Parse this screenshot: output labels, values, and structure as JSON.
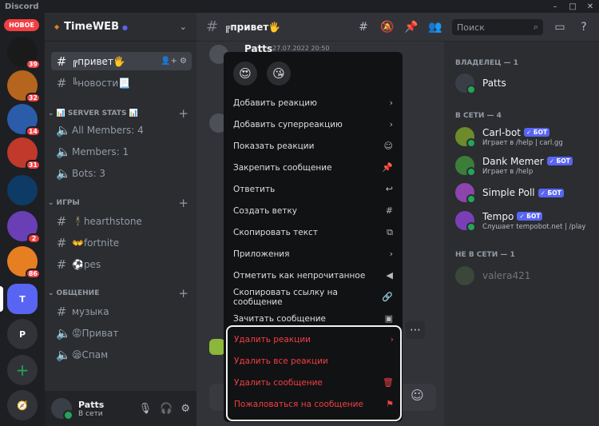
{
  "app": {
    "name": "Discord"
  },
  "window_controls": [
    "–",
    "□",
    "✕"
  ],
  "servers": {
    "new_label": "НОВОЕ",
    "items": [
      {
        "badge": "39",
        "color": "#1a1a1a"
      },
      {
        "badge": "32",
        "color": "#b5651d"
      },
      {
        "badge": "14",
        "color": "#2a5caa"
      },
      {
        "badge": "31",
        "color": "#c0392b"
      },
      {
        "badge": "",
        "color": "#0d3b66"
      },
      {
        "badge": "2",
        "color": "#6a3fb5"
      },
      {
        "badge": "86",
        "color": "#e67e22"
      }
    ],
    "active_label": "T",
    "p_label": "P",
    "add_icon": "plus-icon",
    "explore_icon": "compass-icon"
  },
  "guild": {
    "name": "TimeWEB",
    "channels_top": [
      {
        "name": "╔привет🖐",
        "active": true
      },
      {
        "name": "╚новости📃",
        "active": false
      }
    ],
    "categories": [
      {
        "name": "📊 SERVER STATS 📊",
        "channels": [
          "All Members: 4",
          "Members: 1",
          "Bots: 3"
        ]
      },
      {
        "name": "ИГРЫ",
        "channels": [
          "🕴hearthstone",
          "👐fortnite",
          "⚽pes"
        ]
      },
      {
        "name": "ОБЩЕНИЕ",
        "channels": [
          "музыка",
          "😡Приват",
          "😪Спам"
        ]
      }
    ]
  },
  "user": {
    "name": "Patts",
    "status": "В сети"
  },
  "chat": {
    "channel": "╔привет🖐",
    "search_placeholder": "Поиск",
    "message": {
      "author": "Patts",
      "time": "27.07.2022 20:50"
    }
  },
  "context_menu": {
    "reactions": [
      "😍",
      "😘"
    ],
    "items": [
      {
        "label": "Добавить реакцию",
        "icon": "›"
      },
      {
        "label": "Добавить суперреакцию",
        "icon": "›"
      },
      {
        "label": "Показать реакции",
        "icon": "☺"
      },
      {
        "label": "Закрепить сообщение",
        "icon": "📌"
      },
      {
        "label": "Ответить",
        "icon": "↩"
      },
      {
        "label": "Создать ветку",
        "icon": "#"
      },
      {
        "label": "Скопировать текст",
        "icon": "⧉"
      },
      {
        "label": "Приложения",
        "icon": "›"
      },
      {
        "label": "Отметить как непрочитанное",
        "icon": "◀"
      },
      {
        "label": "Скопировать ссылку на сообщение",
        "icon": "🔗"
      },
      {
        "label": "Зачитать сообщение",
        "icon": "▣"
      }
    ],
    "danger_items": [
      {
        "label": "Удалить реакции",
        "icon": "›"
      },
      {
        "label": "Удалить все реакции",
        "icon": ""
      },
      {
        "label": "Удалить сообщение",
        "icon": "🗑"
      },
      {
        "label": "Пожаловаться на сообщение",
        "icon": "⚑"
      }
    ]
  },
  "members": {
    "owner_header": "ВЛАДЕЛЕЦ — 1",
    "owner": {
      "name": "Patts"
    },
    "online_header": "В СЕТИ — 4",
    "online": [
      {
        "name": "Carl-bot",
        "activity": "Играет в /help | carl.gg",
        "color": "#6d8b2a"
      },
      {
        "name": "Dank Memer",
        "activity": "Играет в /help",
        "color": "#3c7d3a"
      },
      {
        "name": "Simple Poll",
        "activity": "",
        "color": "#8e44ad"
      },
      {
        "name": "Tempo",
        "activity": "Слушает tempobot.net | /play",
        "color": "#7b3fb5"
      }
    ],
    "bot_label": "✓ БОТ",
    "offline_header": "НЕ В СЕТИ — 1",
    "offline": [
      {
        "name": "valera421"
      }
    ]
  }
}
